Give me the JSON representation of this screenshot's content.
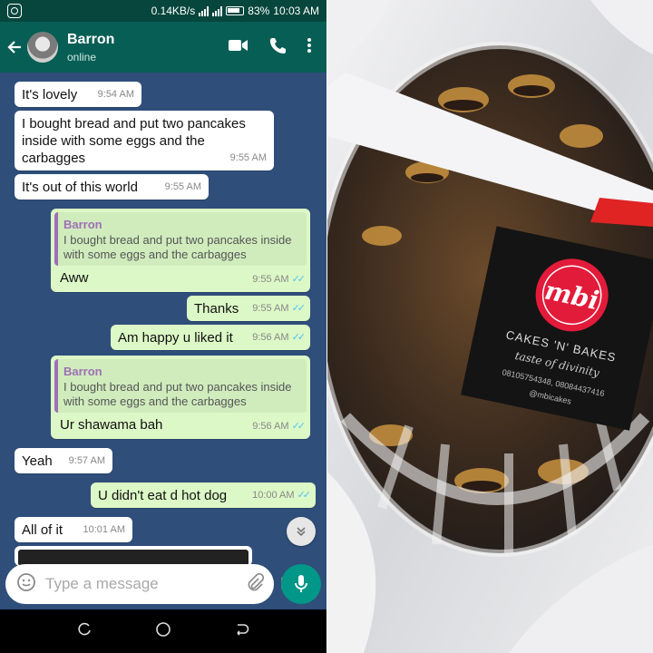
{
  "status_bar": {
    "network_speed": "0.14KB/s",
    "battery": "83%",
    "time": "10:03 AM"
  },
  "header": {
    "contact_name": "Barron",
    "contact_status": "online"
  },
  "messages": [
    {
      "dir": "in",
      "text": "It's lovely",
      "time": "9:54 AM"
    },
    {
      "dir": "in",
      "text": "I bought bread and put two pancakes inside with some eggs and the carbagges",
      "time": "9:55 AM"
    },
    {
      "dir": "in",
      "text": "It's out of this world",
      "time": "9:55 AM"
    },
    {
      "dir": "out",
      "quote_name": "Barron",
      "quote_text": "I bought bread and put two pancakes inside with some eggs and the carbagges",
      "text": "Aww",
      "time": "9:55 AM"
    },
    {
      "dir": "out",
      "text": "Thanks",
      "time": "9:55 AM"
    },
    {
      "dir": "out",
      "text": "Am happy u liked it",
      "time": "9:56 AM"
    },
    {
      "dir": "out",
      "quote_name": "Barron",
      "quote_text": "I bought bread and put two pancakes inside with some eggs and the carbagges",
      "text": "Ur shawama bah",
      "time": "9:56 AM"
    },
    {
      "dir": "in",
      "text": "Yeah",
      "time": "9:57 AM"
    },
    {
      "dir": "out",
      "text": "U didn't eat d hot dog",
      "time": "10:00 AM"
    },
    {
      "dir": "in",
      "text": "All of it",
      "time": "10:01 AM"
    }
  ],
  "composer": {
    "placeholder": "Type a message"
  },
  "photo": {
    "brand_logo_text": "mbi",
    "brand_name": "CAKES 'N' BAKES",
    "tagline": "taste of divinity",
    "phone": "08105754348, 08084437416",
    "handle": "@mbicakes"
  },
  "colors": {
    "header": "#075e54",
    "status_bar": "#06463c",
    "chat_bg": "#2f4e7a",
    "outgoing_bubble": "#dcf8c6",
    "incoming_bubble": "#ffffff",
    "accent": "#009688"
  }
}
